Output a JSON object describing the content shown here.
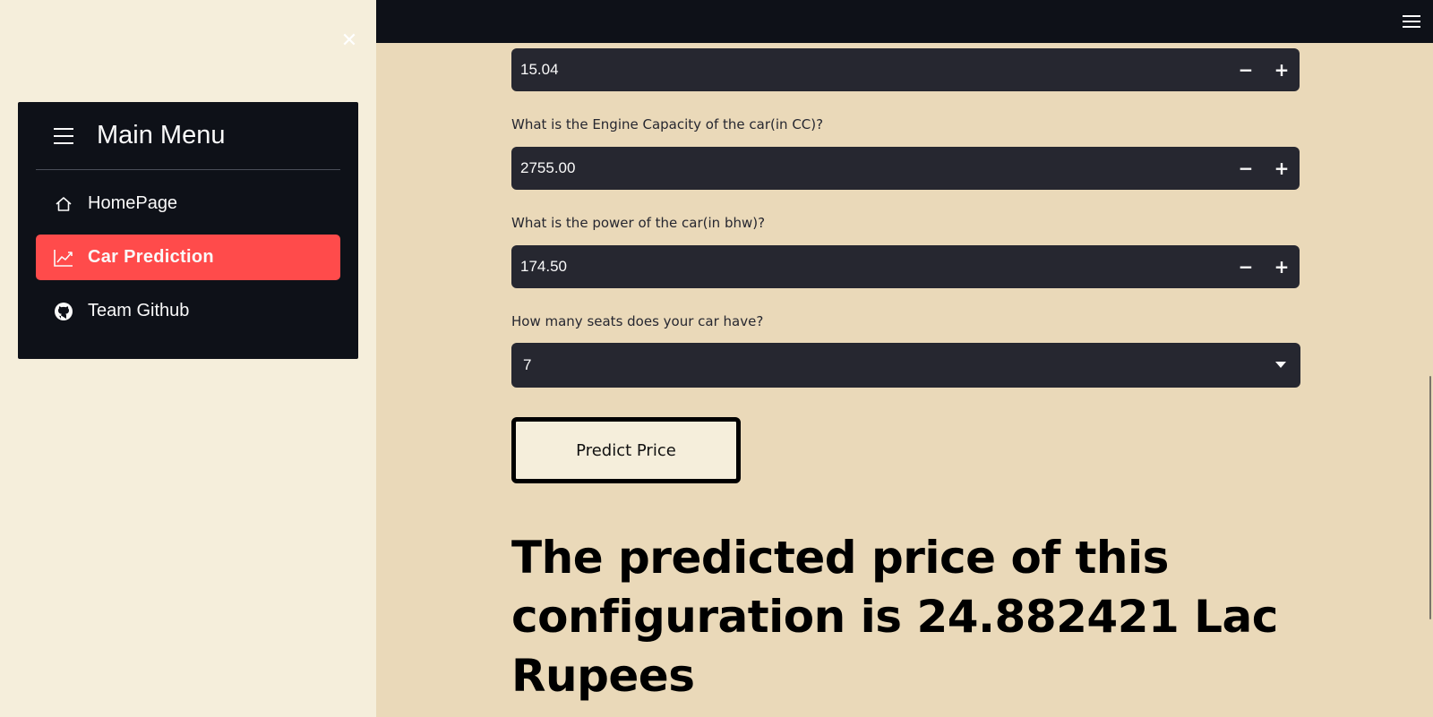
{
  "sidebar": {
    "close_glyph": "✕",
    "menu": {
      "title": "Main Menu",
      "items": [
        {
          "label": "HomePage",
          "icon": "house-icon",
          "active": false
        },
        {
          "label": "Car Prediction",
          "icon": "chart-line-icon",
          "active": true
        },
        {
          "label": "Team Github",
          "icon": "github-icon",
          "active": false
        }
      ]
    }
  },
  "form": {
    "mileage_value": "15.04",
    "engine_label": "What is the Engine Capacity of the car(in CC)?",
    "engine_value": "2755.00",
    "power_label": "What is the power of the car(in bhw)?",
    "power_value": "174.50",
    "seats_label": "How many seats does your car have?",
    "seats_value": "7",
    "minus": "−",
    "plus": "+",
    "predict_button": "Predict Price"
  },
  "result": {
    "text": "The predicted price of this configuration is 24.882421 Lac Rupees"
  },
  "colors": {
    "accent": "#ff4b4b",
    "dark": "#0e1118",
    "input_bg": "#262730",
    "page_bg": "#ead9b9",
    "sidebar_bg": "#f5eedb"
  }
}
